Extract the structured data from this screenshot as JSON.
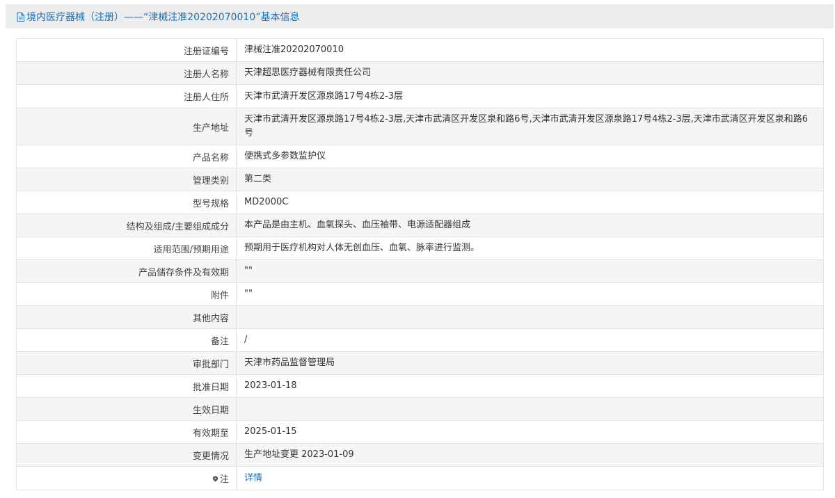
{
  "header": {
    "title": "境内医疗器械（注册）——“津械注准20202070010”基本信息",
    "icon": "document-icon"
  },
  "rows": [
    {
      "label": "注册证编号",
      "value": "津械注准20202070010"
    },
    {
      "label": "注册人名称",
      "value": "天津超思医疗器械有限责任公司"
    },
    {
      "label": "注册人住所",
      "value": "天津市武清开发区源泉路17号4栋2-3层"
    },
    {
      "label": "生产地址",
      "value": "天津市武清开发区源泉路17号4栋2-3层,天津市武清区开发区泉和路6号,天津市武清开发区源泉路17号4栋2-3层,天津市武清区开发区泉和路6号"
    },
    {
      "label": "产品名称",
      "value": "便携式多参数监护仪"
    },
    {
      "label": "管理类别",
      "value": "第二类"
    },
    {
      "label": "型号规格",
      "value": "MD2000C"
    },
    {
      "label": "结构及组成/主要组成成分",
      "value": "本产品是由主机、血氧探头、血压袖带、电源适配器组成"
    },
    {
      "label": "适用范围/预期用途",
      "value": "预期用于医疗机构对人体无创血压、血氧、脉率进行监测。"
    },
    {
      "label": "产品储存条件及有效期",
      "value": "\"\""
    },
    {
      "label": "附件",
      "value": "\"\""
    },
    {
      "label": "其他内容",
      "value": ""
    },
    {
      "label": "备注",
      "value": "/"
    },
    {
      "label": "审批部门",
      "value": "天津市药品监督管理局"
    },
    {
      "label": "批准日期",
      "value": "2023-01-18"
    },
    {
      "label": "生效日期",
      "value": ""
    },
    {
      "label": "有效期至",
      "value": "2025-01-15"
    },
    {
      "label": "变更情况",
      "value": "生产地址变更 2023-01-09"
    }
  ],
  "note_row": {
    "label": "注",
    "icon": "map-pin-icon",
    "link_text": "详情"
  }
}
